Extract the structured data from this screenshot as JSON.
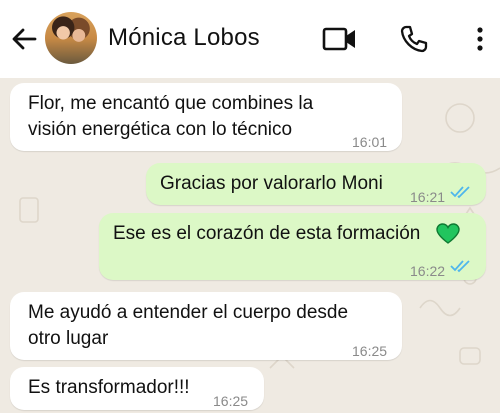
{
  "header": {
    "contact_name": "Mónica Lobos",
    "icons": [
      "back-arrow-icon",
      "avatar",
      "video-call-icon",
      "phone-icon",
      "more-vert-icon"
    ]
  },
  "messages": [
    {
      "direction": "in",
      "text_line1": "Flor, me encantó que combines la",
      "text_line2": "visión energética con lo técnico",
      "time": "16:01"
    },
    {
      "direction": "out",
      "text": "Gracias por valorarlo Moni",
      "time": "16:21",
      "status": "read"
    },
    {
      "direction": "out",
      "text": "Ese es el corazón de esta formación",
      "emoji": "green-heart-icon",
      "time": "16:22",
      "status": "read"
    },
    {
      "direction": "in",
      "text_line1": "Me ayudó a entender el cuerpo desde",
      "text_line2": "otro lugar",
      "time": "16:25"
    },
    {
      "direction": "in",
      "text": "Es transformador!!!",
      "time": "16:25"
    }
  ],
  "colors": {
    "chat_bg": "#efeae2",
    "incoming_bubble": "#ffffff",
    "outgoing_bubble": "#dcf8c6",
    "read_ticks": "#4fb6ec",
    "heart": "#22c55e"
  }
}
